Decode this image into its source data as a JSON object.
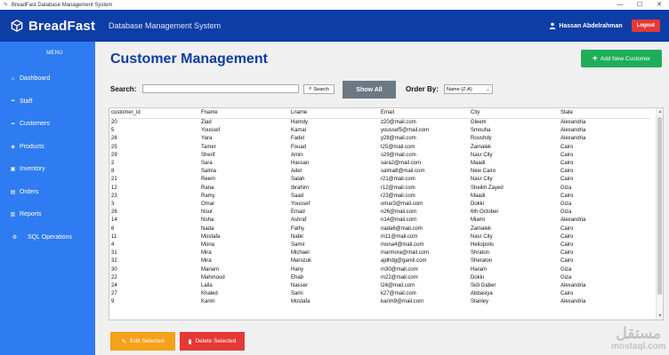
{
  "window": {
    "title": "BreadFast Database Management System",
    "controls": [
      "—",
      "☐",
      "✕"
    ]
  },
  "header": {
    "brand": "BreadFast",
    "subtitle": "Database Management System",
    "user": "Hassan Abdelrahman",
    "logout": "Logout"
  },
  "sidebar": {
    "menu_label": "MENU",
    "items": [
      {
        "label": "Dashboard",
        "icon": "home-icon"
      },
      {
        "label": "Staff",
        "icon": "staff-icon"
      },
      {
        "label": "Customers",
        "icon": "customers-icon"
      },
      {
        "label": "Products",
        "icon": "products-icon"
      },
      {
        "label": "Inventory",
        "icon": "inventory-icon"
      },
      {
        "label": "Orders",
        "icon": "orders-icon"
      },
      {
        "label": "Reports",
        "icon": "reports-icon"
      },
      {
        "label": "SQL Operations",
        "icon": "sql-icon"
      }
    ]
  },
  "main": {
    "title": "Customer Management",
    "add_button": "Add New Customer",
    "search_label": "Search:",
    "search_value": "",
    "search_button": "Search",
    "show_all": "Show All",
    "order_label": "Order By:",
    "order_value": "Name (Z-A)",
    "edit_button": "Edit Selected",
    "delete_button": "Delete Selected"
  },
  "table": {
    "columns": [
      "customer_id",
      "Fname",
      "Lname",
      "Email",
      "City",
      "State"
    ],
    "rows": [
      [
        "20",
        "Ziad",
        "Hamdy",
        "z20@mail.com",
        "Gleem",
        "Alexandria"
      ],
      [
        "5",
        "Youssef",
        "Kamal",
        "youssef5@mail.com",
        "Smouha",
        "Alexandria"
      ],
      [
        "28",
        "Yara",
        "Fadel",
        "y28@mail.com",
        "Roushdy",
        "Alexandria"
      ],
      [
        "25",
        "Tamer",
        "Fouad",
        "t25@mail.com",
        "Zamalek",
        "Cairo"
      ],
      [
        "29",
        "Sherif",
        "Amin",
        "s29@mail.com",
        "Nasr City",
        "Cairo"
      ],
      [
        "2",
        "Sara",
        "Hassan",
        "sara2@mail.com",
        "Maadi",
        "Cairo"
      ],
      [
        "8",
        "Salma",
        "Adel",
        "salma8@mail.com",
        "New Cairo",
        "Cairo"
      ],
      [
        "21",
        "Reem",
        "Salah",
        "r21@mail.com",
        "Nasr City",
        "Cairo"
      ],
      [
        "12",
        "Rana",
        "Ibrahim",
        "r12@mail.com",
        "Sheikh Zayed",
        "Giza"
      ],
      [
        "23",
        "Ramy",
        "Saad",
        "r23@mail.com",
        "Maadi",
        "Cairo"
      ],
      [
        "3",
        "Omar",
        "Youssef",
        "omar3@mail.com",
        "Dokki",
        "Giza"
      ],
      [
        "26",
        "Nour",
        "Emad",
        "n26@mail.com",
        "6th October",
        "Giza"
      ],
      [
        "14",
        "Noha",
        "Ashraf",
        "n14@mail.com",
        "Miami",
        "Alexandria"
      ],
      [
        "6",
        "Nada",
        "Fathy",
        "nada6@mail.com",
        "Zamalek",
        "Cairo"
      ],
      [
        "11",
        "Mostafa",
        "Nabil",
        "m11@mail.com",
        "Nasr City",
        "Cairo"
      ],
      [
        "4",
        "Mona",
        "Samir",
        "mona4@mail.com",
        "Heliopolis",
        "Cairo"
      ],
      [
        "31",
        "Mira",
        "Michael",
        "marmora@mail.com",
        "Shraton",
        "Cairo"
      ],
      [
        "32",
        "Mira",
        "Marozuk",
        "ajdhdg@gamil.com",
        "Sheraton",
        "Cairo"
      ],
      [
        "30",
        "Mariam",
        "Hany",
        "m30@mail.com",
        "Haram",
        "Giza"
      ],
      [
        "22",
        "Mahmoud",
        "Ehab",
        "m22@mail.com",
        "Dokki",
        "Giza"
      ],
      [
        "24",
        "Laila",
        "Nasser",
        "l24@mail.com",
        "Sidi Gaber",
        "Alexandria"
      ],
      [
        "27",
        "Khaled",
        "Sami",
        "k27@mail.com",
        "Abbasiya",
        "Cairo"
      ],
      [
        "9",
        "Karim",
        "Mostafa",
        "karim9@mail.com",
        "Stanley",
        "Alexandria"
      ]
    ]
  },
  "watermark": {
    "arabic": "مستقل",
    "latin": "mostaql.com"
  }
}
